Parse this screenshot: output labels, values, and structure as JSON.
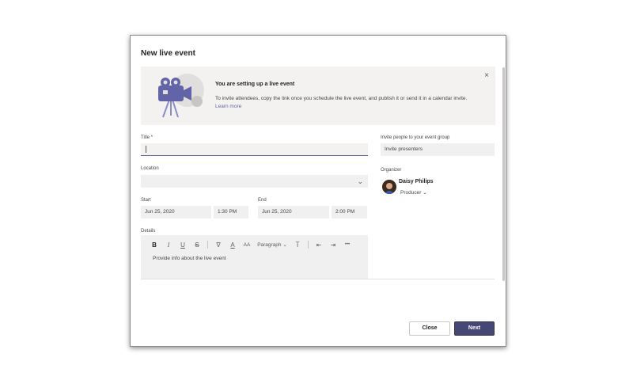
{
  "dialog": {
    "title": "New live event"
  },
  "banner": {
    "close_glyph": "×",
    "heading": "You are setting up a live event",
    "text": "To invite attendees, copy the link once you schedule the live event, and publish it or send it in a calendar invite.",
    "link": "Learn more",
    "illustration_icon": "video-camera-icon"
  },
  "form": {
    "title_label": "Title *",
    "title_value": "",
    "location_label": "Location",
    "location_value": "",
    "start_label": "Start",
    "start_date": "Jun 25, 2020",
    "start_time": "1:30 PM",
    "end_label": "End",
    "end_date": "Jun 25, 2020",
    "end_time": "2:00 PM",
    "details_label": "Details",
    "details_placeholder": "Provide info about the live event",
    "toolbar": {
      "bold": "B",
      "italic": "I",
      "underline": "U",
      "strikethrough": "S",
      "font_color": "A",
      "font_size": "AA",
      "paragraph": "Paragraph",
      "more": "•••"
    }
  },
  "invite": {
    "label": "Invite people to your event group",
    "placeholder": "Invite presenters"
  },
  "organizer": {
    "label": "Organizer",
    "name": "Daisy Philips",
    "role": "Producer"
  },
  "footer": {
    "close_label": "Close",
    "next_label": "Next"
  },
  "colors": {
    "accent": "#6264a7",
    "primary_button": "#464775",
    "field_bg": "#f0f0f0",
    "banner_bg": "#f3f2f1"
  }
}
